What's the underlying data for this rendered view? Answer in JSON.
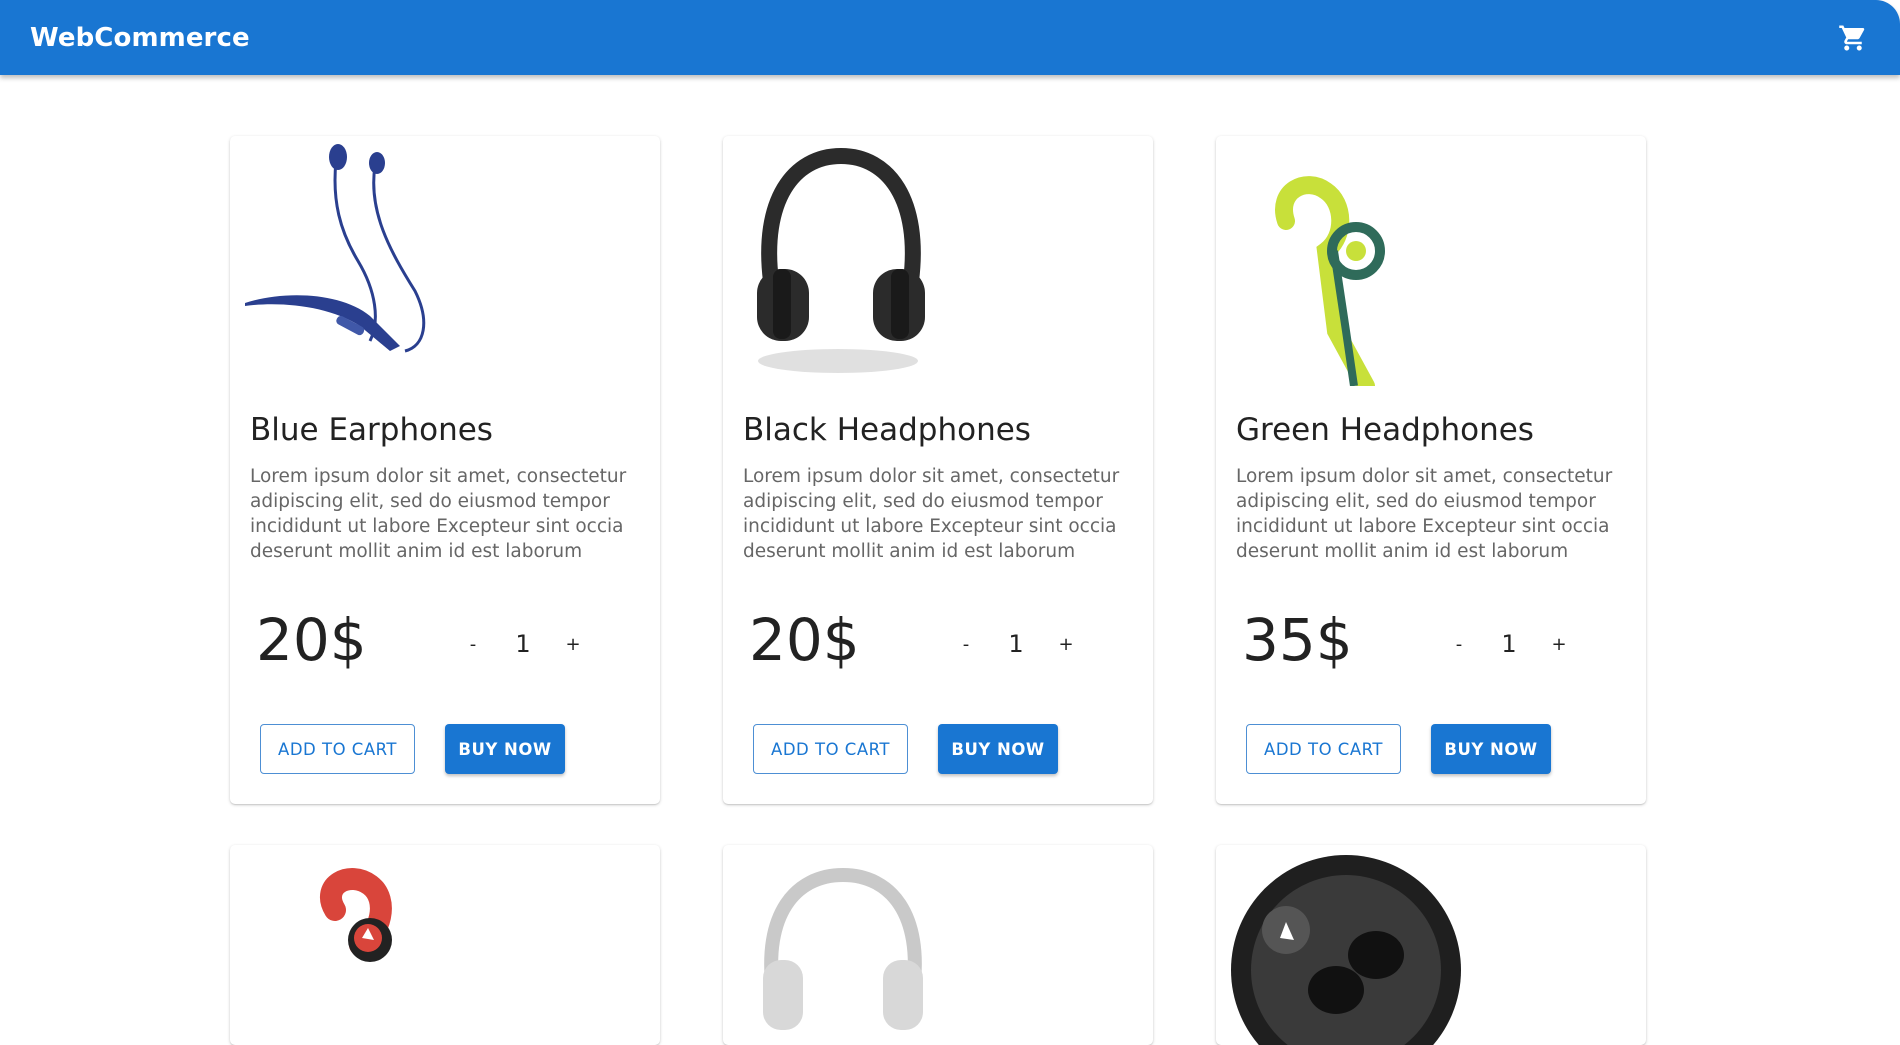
{
  "appbar": {
    "brand": "WebCommerce",
    "cart_icon": "shopping-cart-icon"
  },
  "colors": {
    "primary": "#1976d2",
    "title_text": "#222222",
    "desc_text": "#666666"
  },
  "products": [
    {
      "name": "Blue Earphones",
      "description": "Lorem ipsum dolor sit amet, consectetur adipiscing elit, sed do eiusmod tempor incididunt ut labore Excepteur sint occia deserunt mollit anim id est laborum",
      "price": "20$",
      "quantity": "1",
      "image": "blue-earphones"
    },
    {
      "name": "Black Headphones",
      "description": "Lorem ipsum dolor sit amet, consectetur adipiscing elit, sed do eiusmod tempor incididunt ut labore Excepteur sint occia deserunt mollit anim id est laborum",
      "price": "20$",
      "quantity": "1",
      "image": "black-headphones"
    },
    {
      "name": "Green Headphones",
      "description": "Lorem ipsum dolor sit amet, consectetur adipiscing elit, sed do eiusmod tempor incididunt ut labore Excepteur sint occia deserunt mollit anim id est laborum",
      "price": "35$",
      "quantity": "1",
      "image": "green-headphones"
    },
    {
      "image": "red-earphones"
    },
    {
      "image": "white-headphones"
    },
    {
      "image": "black-earbuds"
    }
  ],
  "controls": {
    "minus": "-",
    "plus": "+",
    "add_to_cart": "ADD TO CART",
    "buy_now": "BUY NOW"
  }
}
